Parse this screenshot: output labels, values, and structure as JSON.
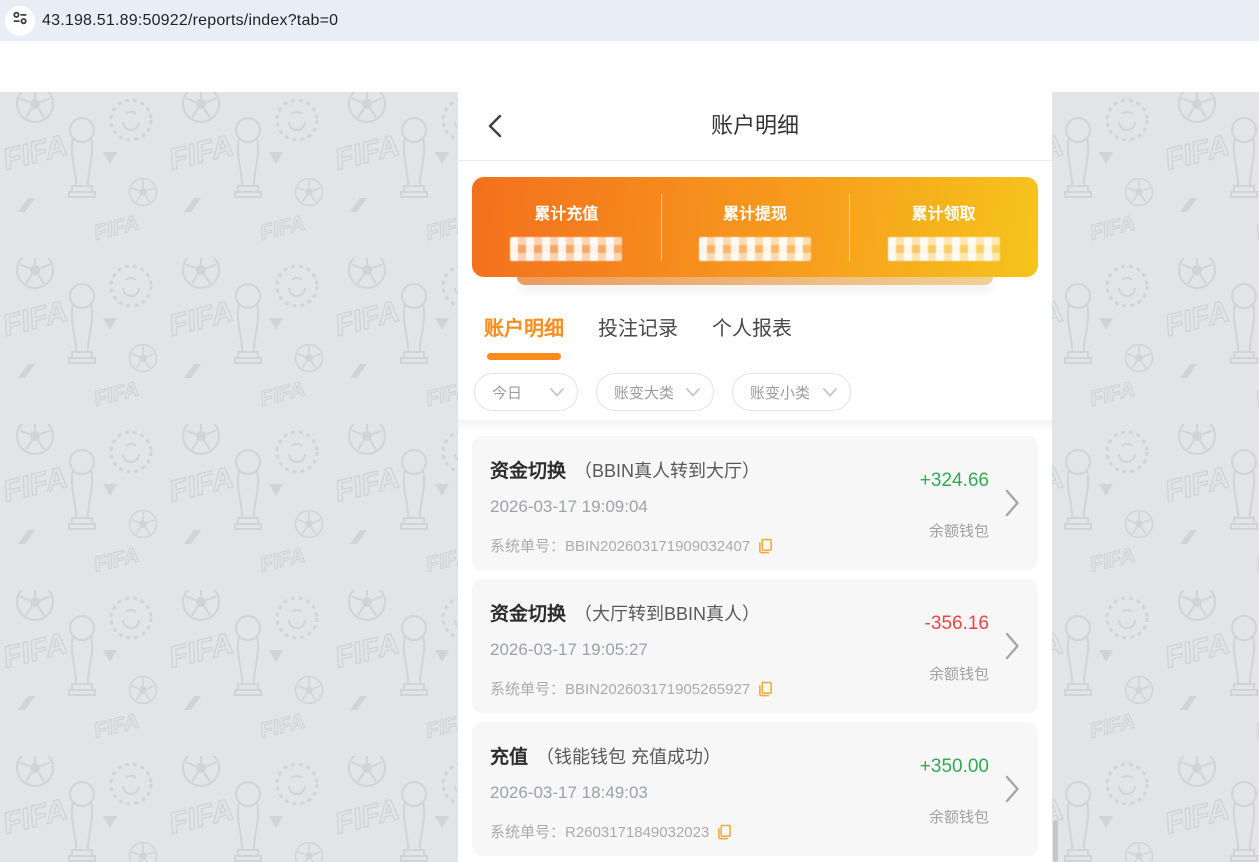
{
  "browser": {
    "url": "43.198.51.89:50922/reports/index?tab=0"
  },
  "header": {
    "title": "账户明细"
  },
  "stats": {
    "values_masked": true,
    "items": [
      {
        "label": "累计充值"
      },
      {
        "label": "累计提现"
      },
      {
        "label": "累计领取"
      }
    ]
  },
  "tabs": [
    {
      "label": "账户明细",
      "active": true
    },
    {
      "label": "投注记录",
      "active": false
    },
    {
      "label": "个人报表",
      "active": false
    }
  ],
  "filters": [
    {
      "label": "今日"
    },
    {
      "label": "账变大类"
    },
    {
      "label": "账变小类"
    }
  ],
  "transactions": [
    {
      "type": "资金切换",
      "note": "（BBIN真人转到大厅）",
      "datetime": "2026-03-17 19:09:04",
      "order": "系统单号：BBIN202603171909032407",
      "amount": "+324.66",
      "direction": "credit",
      "wallet": "余额钱包"
    },
    {
      "type": "资金切换",
      "note": "（大厅转到BBIN真人）",
      "datetime": "2026-03-17 19:05:27",
      "order": "系统单号：BBIN202603171905265927",
      "amount": "-356.16",
      "direction": "debit",
      "wallet": "余额钱包"
    },
    {
      "type": "充值",
      "note": "（钱能钱包 充值成功）",
      "datetime": "2026-03-17 18:49:03",
      "order": "系统单号：R2603171849032023",
      "amount": "+350.00",
      "direction": "credit",
      "wallet": "余额钱包"
    }
  ],
  "colors": {
    "accent_orange": "#ff8c1a",
    "card_gradient_start": "#f3701d",
    "card_gradient_end": "#f6c41c",
    "credit_green": "#34a853",
    "debit_red": "#ee4343",
    "addressbar_bg": "#e9edf6"
  }
}
